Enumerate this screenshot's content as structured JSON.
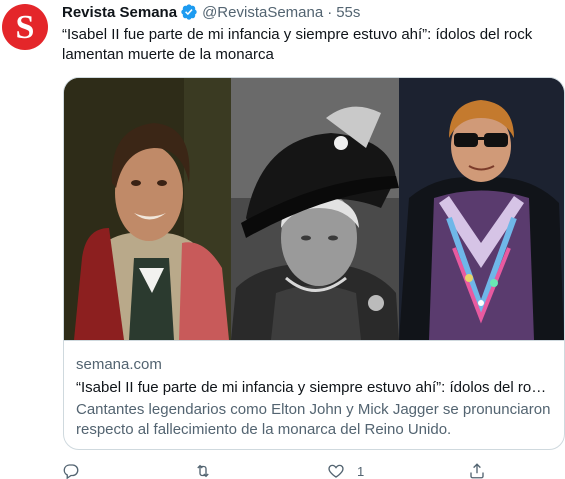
{
  "account": {
    "display_name": "Revista Semana",
    "handle": "@RevistaSemana",
    "separator": "·",
    "time": "55s",
    "avatar_letter": "S",
    "avatar_color": "#e4262a",
    "verified_color": "#1d9bf0"
  },
  "tweet": {
    "text": "“Isabel II fue parte de mi infancia y siempre estuvo ahí”: ídolos del rock lamentan muerte de la monarca"
  },
  "card": {
    "domain": "semana.com",
    "title": "“Isabel II fue parte de mi infancia y siempre estuvo ahí”: ídolos del rock lamentan muerte de la monarca",
    "description": "Cantantes legendarios como Elton John y Mick Jagger se pronunciaron respecto al fallecimiento de la monarca del Reino Unido.",
    "media": [
      "mick-jagger-photo",
      "queen-elizabeth-photo",
      "elton-john-photo"
    ]
  },
  "actions": {
    "reply_icon": "reply-icon",
    "retweet_icon": "retweet-icon",
    "like_icon": "heart-icon",
    "like_count": "1",
    "share_icon": "share-icon"
  }
}
